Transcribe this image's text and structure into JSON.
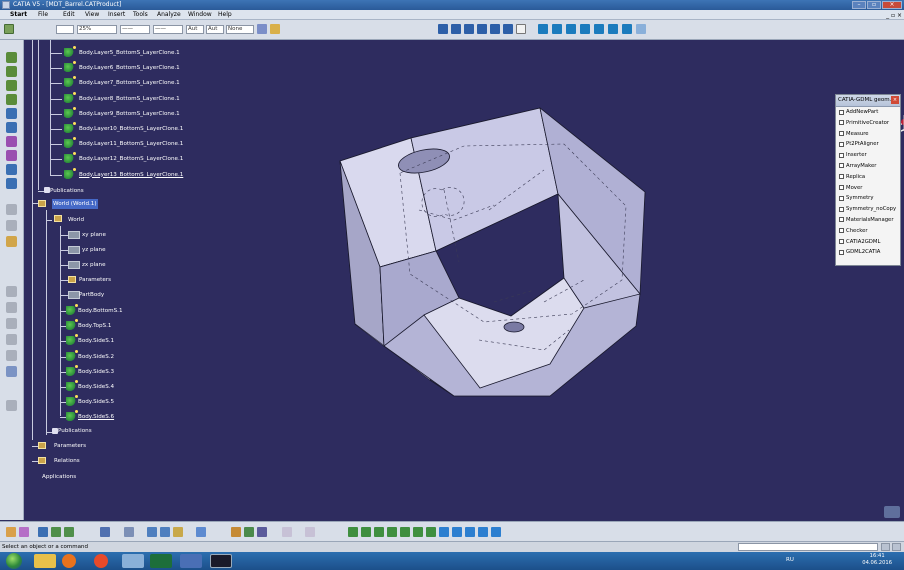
{
  "window": {
    "title": "CATIA V5 - [MDT_Barrel.CATProduct]"
  },
  "menu": {
    "items": [
      "Start",
      "File",
      "Edit",
      "View",
      "Insert",
      "Tools",
      "Analyze",
      "Window",
      "Help"
    ]
  },
  "toolbar": {
    "zoom_value": "25%",
    "line_value": "——",
    "weight_value": "——",
    "layer_value": "Aut",
    "layer2_value": "Aut",
    "filter_value": "None"
  },
  "tree": {
    "layers": [
      "Body.Layer5_BottomS_LayerClone.1",
      "Body.Layer6_BottomS_LayerClone.1",
      "Body.Layer7_BottomS_LayerClone.1",
      "Body.Layer8_BottomS_LayerClone.1",
      "Body.Layer9_BottomS_LayerClone.1",
      "Body.Layer10_BottomS_LayerClone.1",
      "Body.Layer11_BottomS_LayerClone.1",
      "Body.Layer12_BottomS_LayerClone.1",
      "Body.Layer13_BottomS_LayerClone.1"
    ],
    "publications_1": "Publications",
    "world_root": "World (World.1)",
    "world": "World",
    "planes": [
      "xy plane",
      "yz plane",
      "zx plane"
    ],
    "parameters_1": "Parameters",
    "partbody": "PartBody",
    "bodies": [
      "Body.BottomS.1",
      "Body.TopS.1",
      "Body.SideS.1",
      "Body.SideS.2",
      "Body.SideS.3",
      "Body.SideS.4",
      "Body.SideS.5",
      "Body.SideS.6"
    ],
    "publications_2": "Publications",
    "parameters_2": "Parameters",
    "relations": "Relations",
    "applications": "Applications"
  },
  "gdml_panel": {
    "title": "CATIA-GDML geom...",
    "items": [
      "AddNewPart",
      "PrimitiveCreator",
      "Measure",
      "Pt2PtAligner",
      "Inserter",
      "ArrayMaker",
      "Replica",
      "Mover",
      "Symmetry",
      "Symmetry_noCopy",
      "MaterialsManager",
      "Checker",
      "CATIA2GDML",
      "GDML2CATIA"
    ]
  },
  "status": {
    "text": "Select an object or a command"
  },
  "taskbar": {
    "lang": "RU",
    "time": "16:41",
    "date": "04.06.2016"
  },
  "colors": {
    "canvas": "#2e2c5f",
    "selection": "#4569c7",
    "part_face": "#b8b8dc"
  }
}
